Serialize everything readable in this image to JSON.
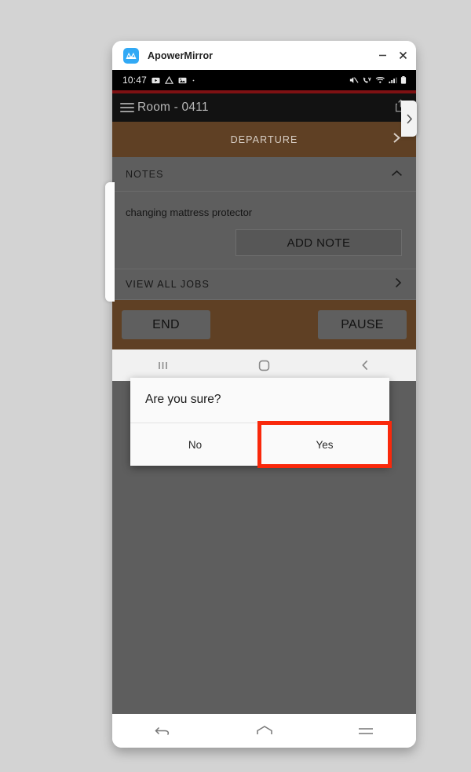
{
  "desktop": {
    "background_color": "#d3d3d3"
  },
  "window": {
    "app_name": "ApowerMirror",
    "logo_icon": "apowermirror-logo-icon",
    "minimize_label": "–",
    "close_label": "✕"
  },
  "phone": {
    "status_bar": {
      "time": "10:47",
      "left_icons": [
        "youtube-icon",
        "google-drive-icon",
        "photos-icon",
        "dot-icon"
      ],
      "right_icons": [
        "mute-icon",
        "volte-call-icon",
        "wifi-icon",
        "signal-icon",
        "battery-icon"
      ]
    },
    "app_bar": {
      "menu_icon": "hamburger-menu-icon",
      "title": "Room - 0411",
      "share_icon": "share-icon"
    },
    "departure": {
      "label": "DEPARTURE",
      "chevron_icon": "chevron-right-icon",
      "background_color": "#5f4024"
    },
    "notes": {
      "header": "NOTES",
      "collapse_icon": "chevron-up-icon",
      "note_text": "changing mattress protector",
      "add_note_label": "ADD NOTE"
    },
    "view_all_jobs": {
      "label": "VIEW ALL JOBS",
      "chevron_icon": "chevron-right-icon"
    },
    "action_bar": {
      "end_label": "END",
      "pause_label": "PAUSE"
    },
    "dialog": {
      "title": "Are you sure?",
      "no_label": "No",
      "yes_label": "Yes",
      "highlight_color": "#f9280b"
    },
    "nav_bar": {
      "recents_icon": "recents-icon",
      "home_icon": "home-square-icon",
      "back_icon": "back-chevron-icon"
    },
    "side_handles": {
      "right_icon": "chevron-right-icon",
      "left_icon": "panel-handle-icon"
    }
  },
  "pc_nav_bar": {
    "back_icon": "back-arrow-icon",
    "home_icon": "home-icon",
    "menu_icon": "menu-icon"
  }
}
